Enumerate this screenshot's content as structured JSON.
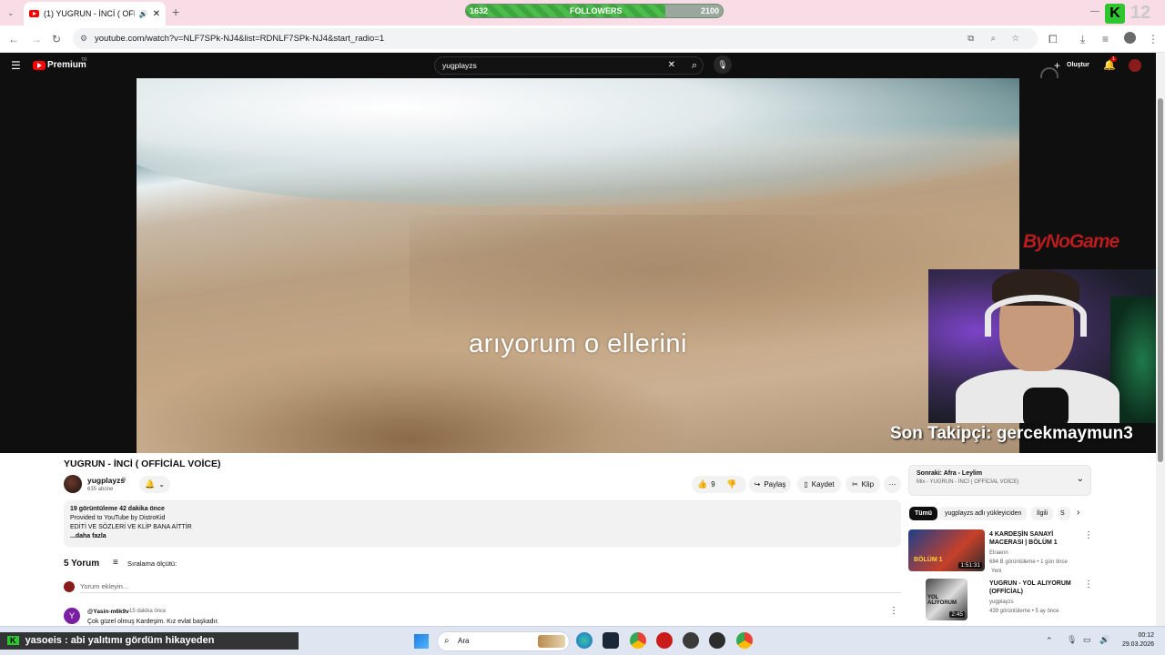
{
  "browser": {
    "tab_title": "(1) YUGRUN - İNCİ ( OFFİCİ",
    "url": "youtube.com/watch?v=NLF7SPk-NJ4&list=RDNLF7SPk-NJ4&start_radio=1"
  },
  "followers_bar": {
    "current": "1632",
    "label": "FOLLOWERS",
    "goal": "2100",
    "progress_fraction": 0.777,
    "corner_number": "12"
  },
  "youtube": {
    "logo_text": "Premium",
    "region": "TR",
    "search_value": "yugplayzs",
    "create_label": "Oluştur",
    "notification_count": "1"
  },
  "video": {
    "lyric": "arıyorum o ellerini",
    "overlay_brand": "ByNoGame",
    "last_follower": "Son Takipçi: gercekmaymun3"
  },
  "watch": {
    "title": "YUGRUN - İNCİ ( OFFİCİAL VOİCE)",
    "channel": "yugplayzs",
    "subscribers": "635 abone",
    "likes": "9",
    "share": "Paylaş",
    "save": "Kaydet",
    "clip": "Klip",
    "desc_stats": "19 görüntüleme  42 dakika önce",
    "desc_line1": "Provided to YouTube by DistroKid",
    "desc_line2": "EDİTİ VE SÖZLERİ VE KLİP BANA AİTTİR",
    "desc_more": "...daha fazla",
    "comments_count": "5 Yorum",
    "sort_label": "Sıralama ölçütü:",
    "comment_placeholder": "Yorum ekleyin...",
    "comment": {
      "initial": "Y",
      "author": "@Yasin-m6k9v",
      "time": "15 dakika önce",
      "text": "Çok güzel olmuş Kardeşim. Kız evlat başkadır."
    }
  },
  "sidebar": {
    "next_label": "Sonraki: Afra - Leylim",
    "mix_label": "Mix - YUGRUN - İNCİ ( OFFİCİAL VOİCE)",
    "chips": [
      "Tümü",
      "yugplayzs adlı yükleyiciden",
      "İlgili",
      "S"
    ],
    "videos": [
      {
        "title": "4 KARDEŞİN SANAYİ MACERASI | BÖLÜM 1",
        "channel": "Elraenn",
        "meta": "684 B görüntüleme • 1 gün önce",
        "badge": "Yeni",
        "duration": "1:51:31",
        "thumb_label": "BÖLÜM 1"
      },
      {
        "title": "YUGRUN - YOL ALIYORUM (OFFİCİAL)",
        "channel": "yugplayzs",
        "meta": "439 görüntüleme • 5 ay önce",
        "badge": "",
        "duration": "2:45",
        "thumb_label": "YOL ALIYORUM"
      }
    ]
  },
  "stream_chat": "yasoeis : abi yalıtımı gördüm hikayeden",
  "taskbar": {
    "search_label": "Ara",
    "time": "00:12",
    "date": "29.03.2026"
  }
}
